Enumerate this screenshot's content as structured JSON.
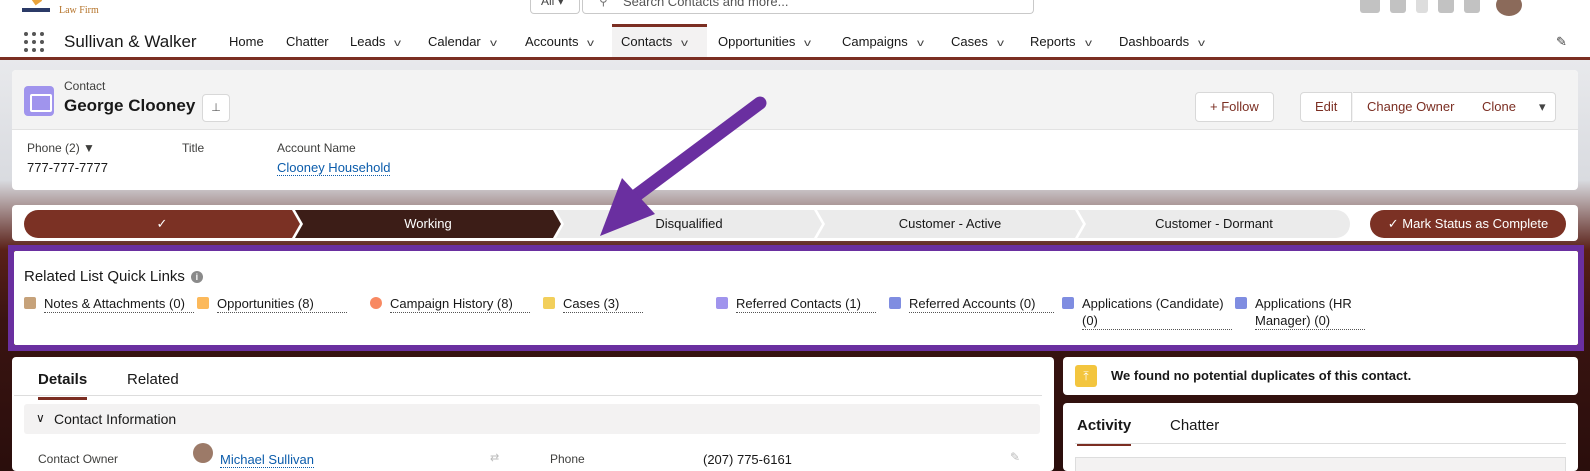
{
  "header_bar": {
    "logo_text": "Law Firm",
    "search_scope": "All",
    "search_placeholder": "Search Contacts and more..."
  },
  "nav": {
    "app_name": "Sullivan & Walker",
    "items": [
      {
        "label": "Home",
        "dropdown": false
      },
      {
        "label": "Chatter",
        "dropdown": false
      },
      {
        "label": "Leads",
        "dropdown": true
      },
      {
        "label": "Calendar",
        "dropdown": true
      },
      {
        "label": "Accounts",
        "dropdown": true
      },
      {
        "label": "Contacts",
        "dropdown": true,
        "active": true
      },
      {
        "label": "Opportunities",
        "dropdown": true
      },
      {
        "label": "Campaigns",
        "dropdown": true
      },
      {
        "label": "Cases",
        "dropdown": true
      },
      {
        "label": "Reports",
        "dropdown": true
      },
      {
        "label": "Dashboards",
        "dropdown": true
      }
    ],
    "chevron_glyph": "v"
  },
  "record": {
    "object_label": "Contact",
    "name": "George Clooney",
    "follow_label": "Follow",
    "follow_plus": "+",
    "actions": [
      "Edit",
      "Change Owner",
      "Clone"
    ],
    "more_glyph": "▾",
    "fields": {
      "phone_label": "Phone (2)",
      "phone_value": "777-777-7777",
      "title_label": "Title",
      "account_label": "Account Name",
      "account_value": "Clooney Household"
    }
  },
  "path": {
    "stages": [
      {
        "label": "✓",
        "state": "done"
      },
      {
        "label": "Working",
        "state": "current"
      },
      {
        "label": "Disqualified",
        "state": "todo"
      },
      {
        "label": "Customer - Active",
        "state": "todo"
      },
      {
        "label": "Customer - Dormant",
        "state": "todo"
      }
    ],
    "complete_label": "Mark Status as Complete",
    "complete_check": "✓"
  },
  "quick_links": {
    "title": "Related List Quick Links",
    "info_glyph": "i",
    "links": [
      {
        "label": "Notes & Attachments (0)",
        "color": "#c6a27a"
      },
      {
        "label": "Opportunities (8)",
        "color": "#fcb95b"
      },
      {
        "label": "Campaign History (8)",
        "color": "#f88962"
      },
      {
        "label": "Cases (3)",
        "color": "#f2cf5b"
      },
      {
        "label": "Referred Contacts (1)",
        "color": "#a094ed"
      },
      {
        "label": "Referred Accounts (0)",
        "color": "#7f8de1"
      },
      {
        "label": "Applications (Candidate) (0)",
        "color": "#7f8de1"
      },
      {
        "label": "Applications (HR Manager) (0)",
        "color": "#7f8de1"
      }
    ],
    "highlight_color": "#6a2fa0"
  },
  "details": {
    "tabs": [
      "Details",
      "Related"
    ],
    "section_title": "Contact Information",
    "section_chevron": "∨",
    "owner_label": "Contact Owner",
    "owner_value": "Michael Sullivan",
    "phone_label": "Phone",
    "phone_value": "(207) 775-6161"
  },
  "duplicates": {
    "message": "We found no potential duplicates of this contact."
  },
  "activity": {
    "tabs": [
      "Activity",
      "Chatter"
    ]
  },
  "colors": {
    "brand": "#7b2e22",
    "arrow": "#6a2fa0",
    "link": "#0b5cab"
  }
}
